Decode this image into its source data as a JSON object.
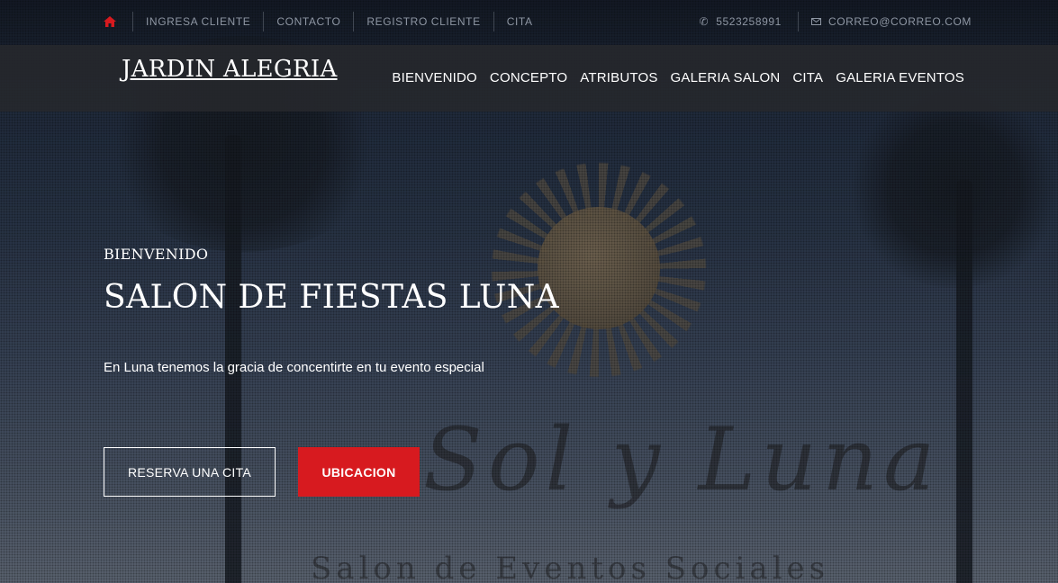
{
  "colors": {
    "accent": "#d71a1f",
    "navbar_bg": "#26282c",
    "topbar_text": "#8e96a3"
  },
  "topbar": {
    "home_icon": "home-icon",
    "links": [
      {
        "label": "INGRESA CLIENTE"
      },
      {
        "label": "CONTACTO"
      },
      {
        "label": "REGISTRO CLIENTE"
      },
      {
        "label": "CITA"
      }
    ],
    "phone_icon": "phone-icon",
    "phone": "5523258991",
    "email_icon": "envelope-icon",
    "email": "CORREO@CORREO.COM"
  },
  "navbar": {
    "brand": "JARDIN ALEGRIA",
    "links": [
      {
        "label": "BIENVENIDO"
      },
      {
        "label": "CONCEPTO"
      },
      {
        "label": "ATRIBUTOS"
      },
      {
        "label": "GALERIA SALON"
      },
      {
        "label": "CITA"
      },
      {
        "label": "GALERIA EVENTOS"
      }
    ]
  },
  "hero": {
    "eyebrow": "BIENVENIDO",
    "title": "SALON DE FIESTAS LUNA",
    "text": "En Luna tenemos la gracia de concentirte en tu evento especial",
    "primary_button": "RESERVA UNA CITA",
    "secondary_button": "UBICACION"
  }
}
